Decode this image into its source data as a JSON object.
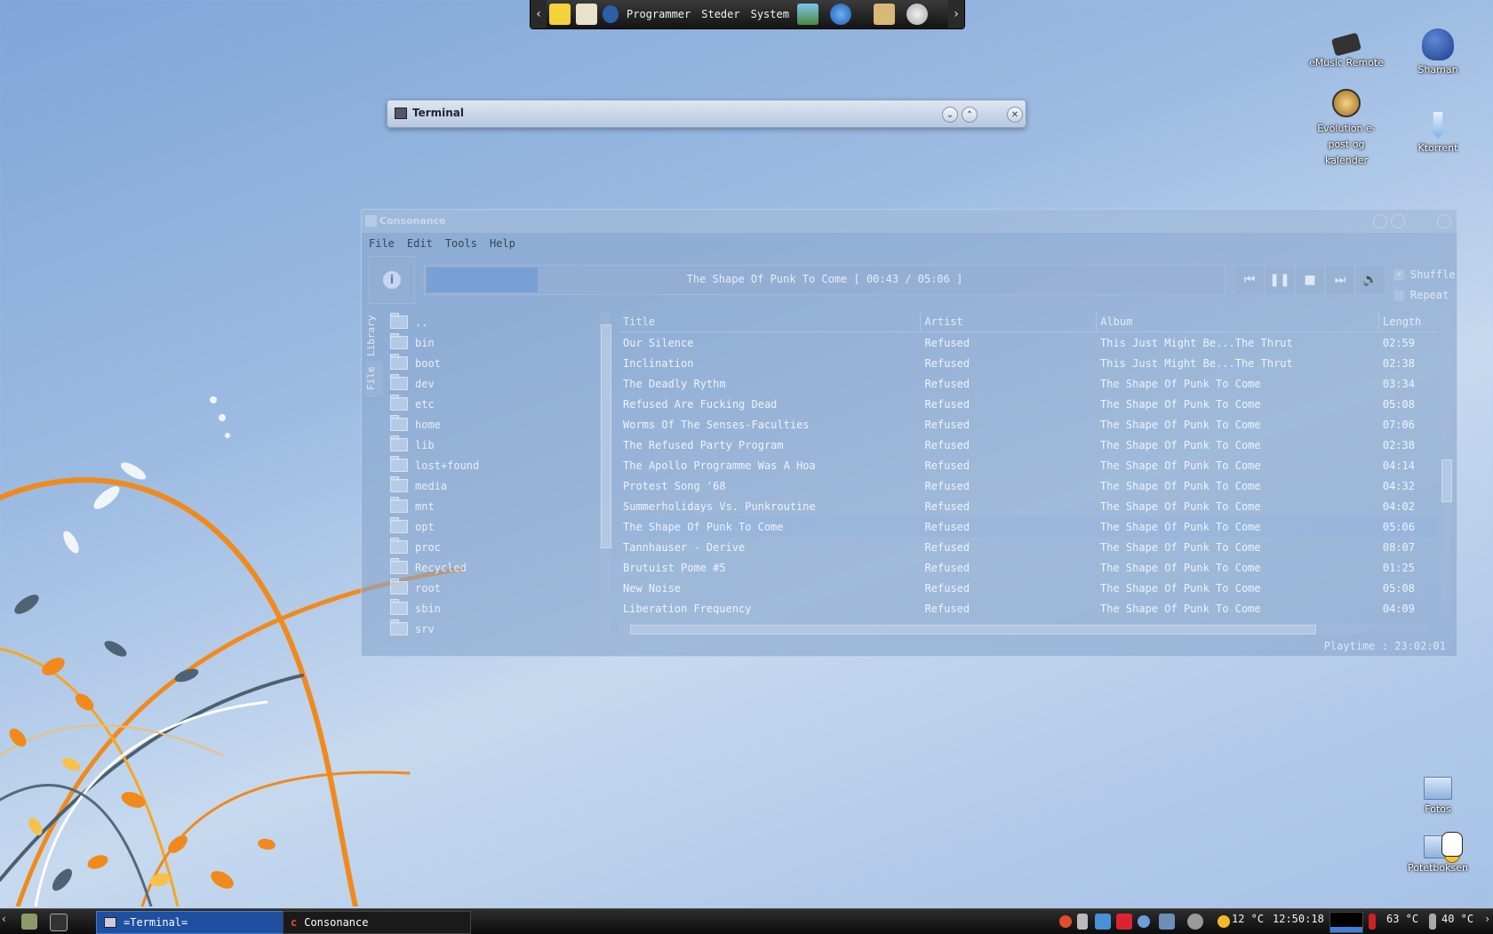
{
  "top_panel": {
    "menus": [
      "Programmer",
      "Steder",
      "System"
    ]
  },
  "desktop_icons": [
    {
      "label": "eMusic Remote"
    },
    {
      "label": "Shaman"
    },
    {
      "label": "Evolution e-post og kalender"
    },
    {
      "label": "Ktorrent"
    },
    {
      "label": "Fotos"
    },
    {
      "label": "Potetboksen"
    }
  ],
  "terminal": {
    "title": "Terminal"
  },
  "consonance": {
    "title": "Consonance",
    "menu": [
      "File",
      "Edit",
      "Tools",
      "Help"
    ],
    "now_playing": "The Shape Of Punk To Come [ 00:43 / 05:06 ]",
    "progress": 0.14,
    "shuffle_label": "Shuffle",
    "shuffle_checked": true,
    "repeat_label": "Repeat",
    "repeat_checked": false,
    "tabs": [
      "Library",
      "File"
    ],
    "files": [
      "..",
      "bin",
      "boot",
      "dev",
      "etc",
      "home",
      "lib",
      "lost+found",
      "media",
      "mnt",
      "opt",
      "proc",
      "Recycled",
      "root",
      "sbin",
      "srv"
    ],
    "columns": [
      "Title",
      "Artist",
      "Album",
      "Length"
    ],
    "tracks": [
      {
        "title": "Our Silence",
        "artist": "Refused",
        "album": "This Just Might Be...The Thrut",
        "length": "02:59"
      },
      {
        "title": "Inclination",
        "artist": "Refused",
        "album": "This Just Might Be...The Thrut",
        "length": "02:38"
      },
      {
        "title": "The Deadly Rythm",
        "artist": "Refused",
        "album": "The Shape Of Punk To Come",
        "length": "03:34"
      },
      {
        "title": "Refused Are Fucking Dead",
        "artist": "Refused",
        "album": "The Shape Of Punk To Come",
        "length": "05:08"
      },
      {
        "title": "Worms Of The Senses-Faculties",
        "artist": "Refused",
        "album": "The Shape Of Punk To Come",
        "length": "07:06"
      },
      {
        "title": "The Refused Party Program",
        "artist": "Refused",
        "album": "The Shape Of Punk To Come",
        "length": "02:38"
      },
      {
        "title": "The Apollo Programme Was A Hoa",
        "artist": "Refused",
        "album": "The Shape Of Punk To Come",
        "length": "04:14"
      },
      {
        "title": "Protest Song '68",
        "artist": "Refused",
        "album": "The Shape Of Punk To Come",
        "length": "04:32"
      },
      {
        "title": "Summerholidays Vs. Punkroutine",
        "artist": "Refused",
        "album": "The Shape Of Punk To Come",
        "length": "04:02"
      },
      {
        "title": "The Shape Of Punk To Come",
        "artist": "Refused",
        "album": "The Shape Of Punk To Come",
        "length": "05:06",
        "selected": true
      },
      {
        "title": "Tannhauser - Derive",
        "artist": "Refused",
        "album": "The Shape Of Punk To Come",
        "length": "08:07"
      },
      {
        "title": "Brutuist Pome #5",
        "artist": "Refused",
        "album": "The Shape Of Punk To Come",
        "length": "01:25"
      },
      {
        "title": "New Noise",
        "artist": "Refused",
        "album": "The Shape Of Punk To Come",
        "length": "05:08"
      },
      {
        "title": "Liberation Frequency",
        "artist": "Refused",
        "album": "The Shape Of Punk To Come",
        "length": "04:09"
      }
    ],
    "playtime": "Playtime : 23:02:01"
  },
  "taskbar": {
    "windows": [
      "=Terminal=",
      "Consonance"
    ],
    "weather": "12 °C",
    "clock": "12:50:18",
    "cpu_temp": "63 °C",
    "gpu_temp": "40 °C"
  },
  "colors": {
    "accent": "#79a0d4",
    "taskbar": "#141414",
    "selected_task": "#1f4fa0"
  }
}
